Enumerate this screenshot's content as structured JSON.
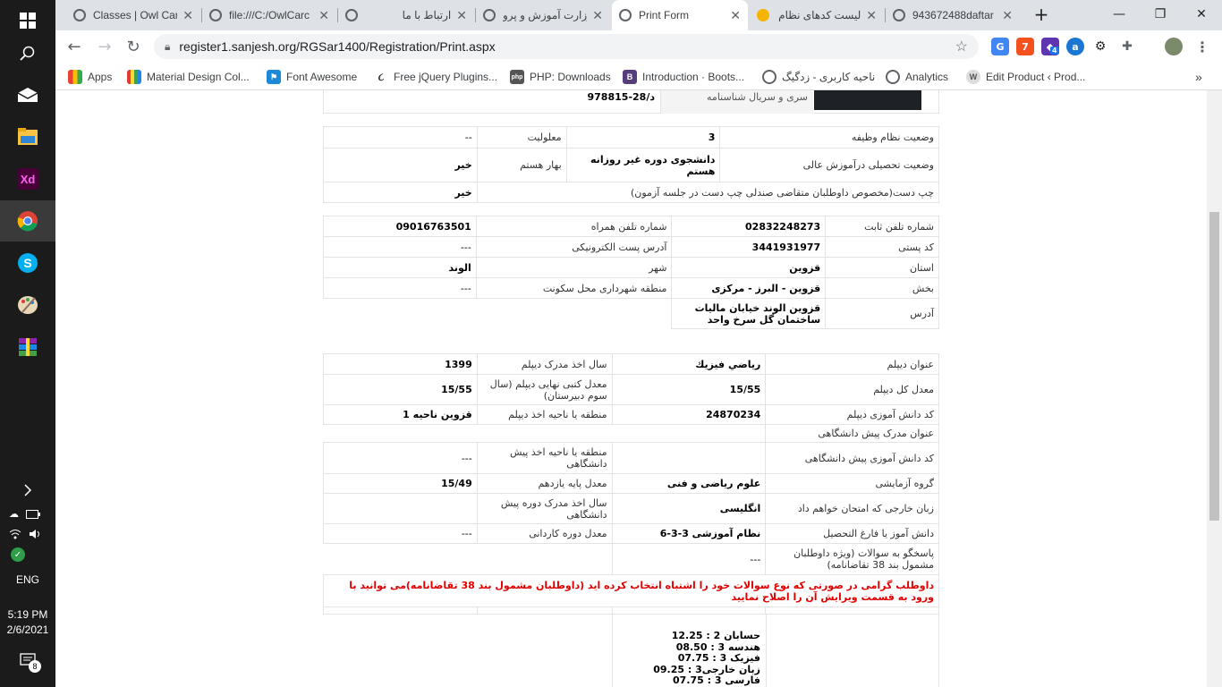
{
  "taskbar": {
    "clock_time": "5:19 PM",
    "clock_date": "2/6/2021",
    "lang": "ENG",
    "notif_count": "8",
    "xd_label": "Xd"
  },
  "browser": {
    "tabs": [
      {
        "title": "Classes | Owl Can"
      },
      {
        "title": "file:///C:/OwlCarc"
      },
      {
        "title": "ارتباط با ما"
      },
      {
        "title": "وزارت آموزش و پرو"
      },
      {
        "title": "Print Form"
      },
      {
        "title": "لیست کدهای نظام"
      },
      {
        "title": "943672488daftar"
      }
    ],
    "url": "register1.sanjesh.org/RGSar1400/Registration/Print.aspx",
    "ext_badge": "4",
    "bookmarks": [
      {
        "label": "Apps"
      },
      {
        "label": "Material Design Col..."
      },
      {
        "label": "Font Awesome"
      },
      {
        "label": "Free jQuery Plugins..."
      },
      {
        "label": "PHP: Downloads"
      },
      {
        "label": "Introduction · Boots..."
      },
      {
        "label": "ناحیه کاربری - زدگیگ"
      },
      {
        "label": "Analytics"
      },
      {
        "label": "Edit Product ‹ Prod..."
      }
    ]
  },
  "form": {
    "idcard": {
      "label": "سری و سریال شناسنامه",
      "value": "د/28-978815"
    },
    "status": {
      "military_label": "وضعیت نظام وظیفه",
      "military_value": "3",
      "disability_label": "معلولیت",
      "disability_value": "--",
      "edu_label": "وضعیت تحصیلی درآموزش عالی",
      "edu_value": "دانشجوی دوره غیر روزانه هستم",
      "semester_label": "بهار هستم",
      "semester_value": "خیر",
      "lefthand_label": "چپ دست(مخصوص داوطلبان متقاضی صندلی چپ دست در جلسه آزمون)",
      "lefthand_value": "خیر"
    },
    "contact": {
      "phone_label": "شماره تلفن ثابت",
      "phone_value": "02832248273",
      "mobile_label": "شماره تلفن همراه",
      "mobile_value": "09016763501",
      "postal_label": "کد پستی",
      "postal_value": "3441931977",
      "email_label": "آدرس پست الکترونیکی",
      "email_value": "---",
      "province_label": "استان",
      "province_value": "قزوین",
      "city_label": "شهر",
      "city_value": "الوند",
      "district_label": "بخش",
      "district_value": "قزوین - البرز - مرکزی",
      "municipal_label": "منطقه شهرداری محل سکونت",
      "municipal_value": "---",
      "address_label": "آدرس",
      "address_value": "قزوین الوند خیابان مالیات ساختمان گل سرخ واحد"
    },
    "diploma": {
      "title_label": "عنوان دیپلم",
      "title_value": "رياضي فيزيك",
      "year_label": "سال اخذ مدرک دیپلم",
      "year_value": "1399",
      "gpa_label": "معدل کل دیپلم",
      "gpa_value": "15/55",
      "written_gpa_label": "معدل کتبی نهایی دیپلم (سال سوم دبیرستان)",
      "written_gpa_value": "15/55",
      "student_code_label": "کد دانش آموزی دیپلم",
      "student_code_value": "24870234",
      "region_label": "منطقه یا ناحیه اخذ دیپلم",
      "region_value": "قزوين ناحيه 1",
      "preuni_title_label": "عنوان مدرک پیش دانشگاهی",
      "preuni_code_label": "کد دانش آموزی پیش دانشگاهی",
      "preuni_region_label": "منطقه یا ناحیه اخذ پیش دانشگاهی",
      "preuni_region_value": "---",
      "group_label": "گروه آزمایشی",
      "group_value": "علوم رياضی و فنی",
      "grade11_label": "معدل پایه یازدهم",
      "grade11_value": "15/49",
      "language_label": "زبان خارجی که امتحان خواهم داد",
      "language_value": "انگلیسی",
      "preuni_year_label": "سال اخذ مدرک دوره پیش دانشگاهی",
      "grad_label": "دانش آموز یا فارغ التحصیل",
      "grad_value": "نظام آموزشی 3-3-6",
      "associate_label": "معدل دوره کاردانی",
      "associate_value": "---",
      "q38_label": "پاسخگو به سوالات (ویژه داوطلبان مشمول بند 38 تقاضانامه)",
      "q38_value": "---",
      "warning": "داوطلب گرامی در صورتی که نوع سوالات خود را اشتباه انتخاب کرده اید (داوطلبان مشمول بند 38 تقاضانامه)می توانید با ورود به قسمت ویرایش آن را اصلاح نمایید"
    },
    "grades": [
      {
        "line": "حسابان 2 : 12.25"
      },
      {
        "line": "هندسه 3 : 08.50"
      },
      {
        "line": "فیزیک 3 : 07.75"
      },
      {
        "line": "زبان خارجی3 : 09.25"
      },
      {
        "line": "فارسی 3 : 07.75"
      }
    ]
  }
}
